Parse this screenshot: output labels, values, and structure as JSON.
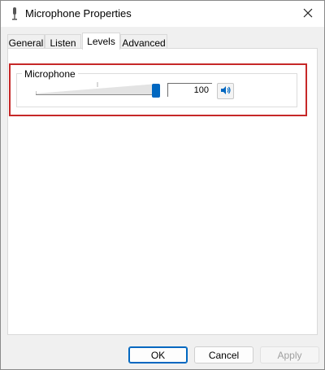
{
  "window": {
    "title": "Microphone Properties",
    "icon": "microphone-icon"
  },
  "tabs": [
    {
      "label": "General",
      "active": false
    },
    {
      "label": "Listen",
      "active": false
    },
    {
      "label": "Levels",
      "active": true
    },
    {
      "label": "Advanced",
      "active": false
    }
  ],
  "levels": {
    "group_label": "Microphone",
    "volume_value": "100",
    "slider_fraction": 1.0,
    "mute_icon": "speaker-icon"
  },
  "buttons": {
    "ok": "OK",
    "cancel": "Cancel",
    "apply": "Apply"
  },
  "colors": {
    "accent": "#0067c0",
    "highlight": "#c62828"
  }
}
